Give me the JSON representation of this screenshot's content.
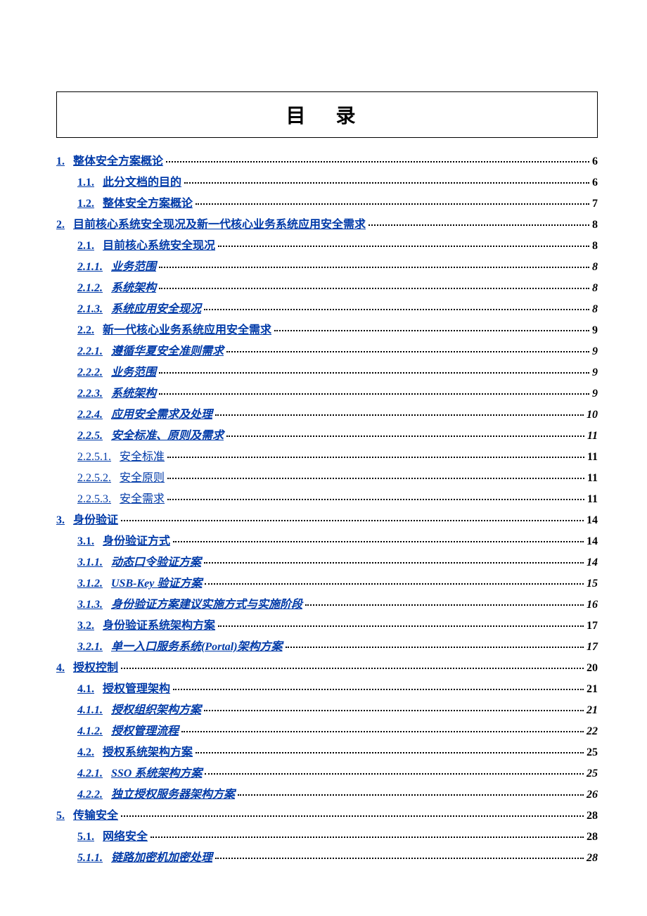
{
  "title": "目 录",
  "items": [
    {
      "num": "1.",
      "title": "整体安全方案概论",
      "page": "6",
      "indent": 0,
      "italic": false,
      "ipage": false
    },
    {
      "num": "1.1.",
      "title": "此分文档的目的",
      "page": "6",
      "indent": 1,
      "italic": false,
      "ipage": false
    },
    {
      "num": "1.2.",
      "title": "整体安全方案概论",
      "page": "7",
      "indent": 1,
      "italic": false,
      "ipage": false
    },
    {
      "num": "2.",
      "title": "目前核心系统安全现况及新一代核心业务系统应用安全需求",
      "page": "8",
      "indent": 0,
      "italic": false,
      "ipage": false
    },
    {
      "num": "2.1.",
      "title": "目前核心系统安全现况",
      "page": "8",
      "indent": 1,
      "italic": false,
      "ipage": false
    },
    {
      "num": "2.1.1.",
      "title": "业务范围",
      "page": "8",
      "indent": 2,
      "italic": true,
      "ipage": true
    },
    {
      "num": "2.1.2.",
      "title": "系统架构",
      "page": "8",
      "indent": 2,
      "italic": true,
      "ipage": true
    },
    {
      "num": "2.1.3.",
      "title": "系统应用安全现况",
      "page": "8",
      "indent": 2,
      "italic": true,
      "ipage": true
    },
    {
      "num": "2.2.",
      "title": "新一代核心业务系统应用安全需求",
      "page": "9",
      "indent": 1,
      "italic": false,
      "ipage": false
    },
    {
      "num": "2.2.1.",
      "title": "遵循华夏安全准则需求",
      "page": "9",
      "indent": 2,
      "italic": true,
      "ipage": true
    },
    {
      "num": "2.2.2.",
      "title": "业务范围",
      "page": "9",
      "indent": 2,
      "italic": true,
      "ipage": true
    },
    {
      "num": "2.2.3.",
      "title": "系统架构",
      "page": "9",
      "indent": 2,
      "italic": true,
      "ipage": true
    },
    {
      "num": "2.2.4.",
      "title": "应用安全需求及处理",
      "page": "10",
      "indent": 2,
      "italic": true,
      "ipage": true
    },
    {
      "num": "2.2.5.",
      "title": "安全标准、原则及需求",
      "page": "11",
      "indent": 2,
      "italic": true,
      "ipage": true
    },
    {
      "num": "2.2.5.1.",
      "title": "安全标准",
      "page": "11",
      "indent": 3,
      "italic": false,
      "ipage": false
    },
    {
      "num": "2.2.5.2.",
      "title": "安全原则",
      "page": "11",
      "indent": 3,
      "italic": false,
      "ipage": false
    },
    {
      "num": "2.2.5.3.",
      "title": "安全需求",
      "page": "11",
      "indent": 3,
      "italic": false,
      "ipage": false
    },
    {
      "num": "3.",
      "title": "身份验证",
      "page": "14",
      "indent": 0,
      "italic": false,
      "ipage": false
    },
    {
      "num": "3.1.",
      "title": "身份验证方式",
      "page": "14",
      "indent": 1,
      "italic": false,
      "ipage": false
    },
    {
      "num": "3.1.1.",
      "title": "动态口令验证方案",
      "page": "14",
      "indent": 2,
      "italic": true,
      "ipage": true
    },
    {
      "num": "3.1.2.",
      "title": "USB-Key 验证方案",
      "page": "15",
      "indent": 2,
      "italic": true,
      "ipage": true
    },
    {
      "num": "3.1.3.",
      "title": "身份验证方案建议实施方式与实施阶段",
      "page": "16",
      "indent": 2,
      "italic": true,
      "ipage": true
    },
    {
      "num": "3.2.",
      "title": "身份验证系统架构方案",
      "page": "17",
      "indent": 1,
      "italic": false,
      "ipage": false
    },
    {
      "num": "3.2.1.",
      "title": "单一入口服务系统(Portal)架构方案",
      "page": "17",
      "indent": 2,
      "italic": true,
      "ipage": true
    },
    {
      "num": "4.",
      "title": "授权控制",
      "page": "20",
      "indent": 0,
      "italic": false,
      "ipage": false
    },
    {
      "num": "4.1.",
      "title": "授权管理架构",
      "page": "21",
      "indent": 1,
      "italic": false,
      "ipage": false
    },
    {
      "num": "4.1.1.",
      "title": "授权组织架构方案",
      "page": "21",
      "indent": 2,
      "italic": true,
      "ipage": true
    },
    {
      "num": "4.1.2.",
      "title": "授权管理流程",
      "page": "22",
      "indent": 2,
      "italic": true,
      "ipage": true
    },
    {
      "num": "4.2.",
      "title": "授权系统架构方案",
      "page": "25",
      "indent": 1,
      "italic": false,
      "ipage": false
    },
    {
      "num": "4.2.1.",
      "title": "SSO 系统架构方案",
      "page": "25",
      "indent": 2,
      "italic": true,
      "ipage": true
    },
    {
      "num": "4.2.2.",
      "title": "独立授权服务器架构方案",
      "page": "26",
      "indent": 2,
      "italic": true,
      "ipage": true
    },
    {
      "num": "5.",
      "title": "传输安全",
      "page": "28",
      "indent": 0,
      "italic": false,
      "ipage": false
    },
    {
      "num": "5.1.",
      "title": "网络安全",
      "page": "28",
      "indent": 1,
      "italic": false,
      "ipage": false
    },
    {
      "num": "5.1.1.",
      "title": "链路加密机加密处理",
      "page": "28",
      "indent": 2,
      "italic": true,
      "ipage": true
    }
  ]
}
